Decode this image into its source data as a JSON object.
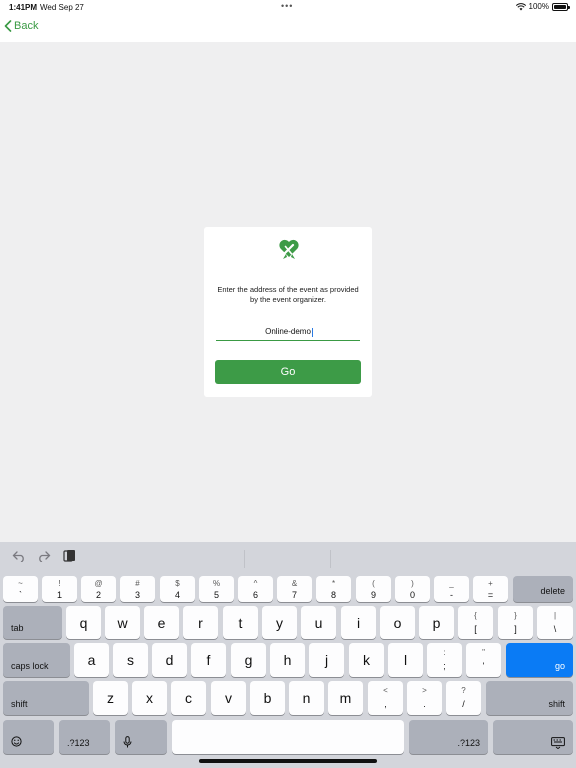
{
  "status_bar": {
    "time": "1:41PM",
    "date": "Wed Sep 27",
    "battery": "100%",
    "battery_level": 1.0
  },
  "nav": {
    "back_label": "Back"
  },
  "card": {
    "instructions": "Enter the address of the event as provided by the event organizer.",
    "input_value": "Online-demo",
    "go_label": "Go"
  },
  "keyboard": {
    "row1": [
      {
        "top": "~",
        "bottom": "`"
      },
      {
        "top": "!",
        "bottom": "1"
      },
      {
        "top": "@",
        "bottom": "2"
      },
      {
        "top": "#",
        "bottom": "3"
      },
      {
        "top": "$",
        "bottom": "4"
      },
      {
        "top": "%",
        "bottom": "5"
      },
      {
        "top": "^",
        "bottom": "6"
      },
      {
        "top": "&",
        "bottom": "7"
      },
      {
        "top": "*",
        "bottom": "8"
      },
      {
        "top": "(",
        "bottom": "9"
      },
      {
        "top": ")",
        "bottom": "0"
      },
      {
        "top": "_",
        "bottom": "-"
      },
      {
        "top": "+",
        "bottom": "="
      }
    ],
    "delete_label": "delete",
    "tab_label": "tab",
    "row2": [
      "q",
      "w",
      "e",
      "r",
      "t",
      "y",
      "u",
      "i",
      "o",
      "p"
    ],
    "row2_symbols": [
      {
        "top": "{",
        "bottom": "["
      },
      {
        "top": "}",
        "bottom": "]"
      },
      {
        "top": "|",
        "bottom": "\\"
      }
    ],
    "caps_lock_label": "caps lock",
    "row3": [
      "a",
      "s",
      "d",
      "f",
      "g",
      "h",
      "j",
      "k",
      "l"
    ],
    "row3_symbols": [
      {
        "top": ":",
        "bottom": ";"
      },
      {
        "top": "\"",
        "bottom": "'"
      }
    ],
    "go_label": "go",
    "shift_label": "shift",
    "row4": [
      "z",
      "x",
      "c",
      "v",
      "b",
      "n",
      "m"
    ],
    "row4_symbols": [
      {
        "top": "<",
        "bottom": ","
      },
      {
        "top": ">",
        "bottom": "."
      },
      {
        "top": "?",
        "bottom": "/"
      }
    ],
    "numbers_label": ".?123"
  }
}
